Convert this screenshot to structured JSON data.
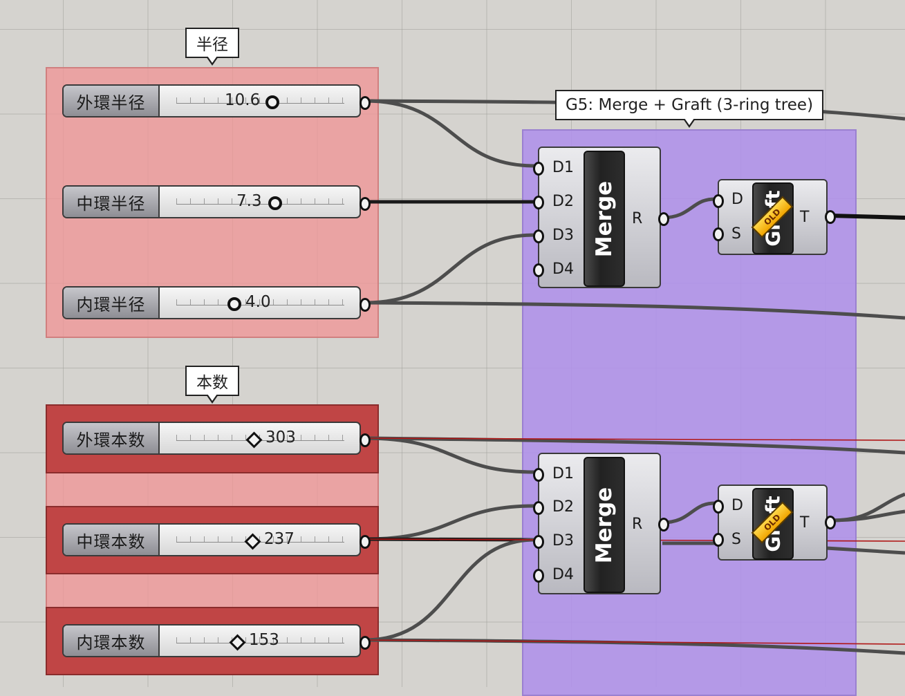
{
  "groups": {
    "radius_label": "半径",
    "count_label": "本数",
    "g5_label": "G5: Merge + Graft (3-ring tree)"
  },
  "sliders": {
    "outer_radius": {
      "name": "外環半径",
      "value": "10.6"
    },
    "middle_radius": {
      "name": "中環半径",
      "value": "7.3"
    },
    "inner_radius": {
      "name": "内環半径",
      "value": "4.0"
    },
    "outer_count": {
      "name": "外環本数",
      "value": "303"
    },
    "middle_count": {
      "name": "中環本数",
      "value": "237"
    },
    "inner_count": {
      "name": "内環本数",
      "value": "153"
    }
  },
  "merge": {
    "title": "Merge",
    "inputs": [
      "D1",
      "D2",
      "D3",
      "D4"
    ],
    "output": "R"
  },
  "graft": {
    "title": "Graft",
    "badge": "OLD",
    "inputs": [
      "D",
      "S"
    ],
    "output": "T"
  }
}
